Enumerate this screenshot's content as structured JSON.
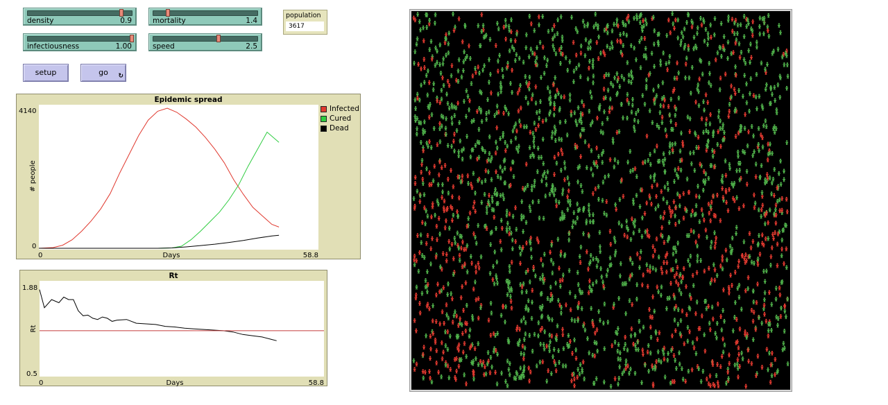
{
  "sliders": [
    {
      "id": "density",
      "label": "density",
      "value": "0.9",
      "fraction": 0.9
    },
    {
      "id": "mortality",
      "label": "mortality",
      "value": "1.4",
      "fraction": 0.14
    },
    {
      "id": "infectiousness",
      "label": "infectiousness",
      "value": "1.00",
      "fraction": 1.0
    },
    {
      "id": "speed",
      "label": "speed",
      "value": "2.5",
      "fraction": 0.625
    }
  ],
  "monitor": {
    "label": "population",
    "value": "3617"
  },
  "buttons": {
    "setup": "setup",
    "go": "go",
    "go_forever_icon": "forever-arrows-icon"
  },
  "plots": {
    "epidemic": {
      "title": "Epidemic spread",
      "xlabel": "Days",
      "ylabel": "# people",
      "xmin": "0",
      "xmax": "58.8",
      "ymin": "0",
      "ymax": "4140",
      "legend": [
        {
          "label": "Infected",
          "color": "#e0392f"
        },
        {
          "label": "Cured",
          "color": "#2ecc40"
        },
        {
          "label": "Dead",
          "color": "#000000"
        }
      ]
    },
    "rt": {
      "title": "Rt",
      "xlabel": "Days",
      "ylabel": "Rt",
      "xmin": "0",
      "xmax": "58.8",
      "ymin": "0.5",
      "ymax": "1.88"
    }
  },
  "chart_data": [
    {
      "type": "line",
      "title": "Epidemic spread",
      "xlabel": "Days",
      "ylabel": "# people",
      "xlim": [
        0,
        58.8
      ],
      "ylim": [
        0,
        4140
      ],
      "series": [
        {
          "name": "Infected",
          "color": "#e0392f",
          "x": [
            0,
            3,
            5,
            7,
            9,
            11,
            13,
            15,
            17,
            19,
            21,
            23,
            25,
            27,
            29,
            31,
            33,
            35,
            37,
            39,
            41,
            43,
            45,
            47,
            49,
            50.5
          ],
          "values": [
            0,
            20,
            90,
            250,
            500,
            800,
            1150,
            1600,
            2200,
            2750,
            3300,
            3750,
            4010,
            4100,
            3980,
            3780,
            3550,
            3250,
            2900,
            2500,
            2000,
            1580,
            1200,
            950,
            700,
            620
          ]
        },
        {
          "name": "Cured",
          "color": "#2ecc40",
          "x": [
            0,
            25,
            28,
            30,
            32,
            34,
            36,
            38,
            40,
            42,
            44,
            46,
            48,
            50.5
          ],
          "values": [
            0,
            0,
            10,
            60,
            250,
            500,
            780,
            1060,
            1420,
            1850,
            2400,
            2900,
            3400,
            3100
          ]
        },
        {
          "name": "Dead",
          "color": "#000000",
          "x": [
            0,
            25,
            28,
            31,
            34,
            37,
            40,
            43,
            46,
            49,
            50.5
          ],
          "values": [
            0,
            0,
            10,
            40,
            80,
            120,
            170,
            230,
            300,
            360,
            380
          ]
        }
      ]
    },
    {
      "type": "line",
      "title": "Rt",
      "xlabel": "Days",
      "ylabel": "Rt",
      "xlim": [
        0,
        58.8
      ],
      "ylim": [
        0.5,
        1.88
      ],
      "series": [
        {
          "color": "#000000",
          "x": [
            0,
            1,
            2.5,
            4,
            5,
            6,
            7,
            8,
            9,
            10,
            11,
            12,
            13,
            14,
            15,
            16,
            18,
            20,
            22,
            24,
            26,
            28,
            30,
            32,
            34,
            36,
            38,
            40,
            42,
            44,
            46,
            48,
            49
          ],
          "values": [
            1.84,
            1.55,
            1.68,
            1.63,
            1.72,
            1.68,
            1.68,
            1.5,
            1.42,
            1.43,
            1.38,
            1.36,
            1.4,
            1.38,
            1.33,
            1.35,
            1.36,
            1.3,
            1.29,
            1.28,
            1.25,
            1.24,
            1.22,
            1.21,
            1.2,
            1.19,
            1.18,
            1.16,
            1.12,
            1.1,
            1.08,
            1.04,
            1.02
          ]
        },
        {
          "color": "#c43b3b",
          "x": [
            0,
            58.8
          ],
          "values": [
            1.18,
            1.18
          ]
        }
      ]
    }
  ],
  "world": {
    "background": "#000000",
    "infected_color": "#e0392f",
    "healthy_color": "#4fb04a"
  }
}
